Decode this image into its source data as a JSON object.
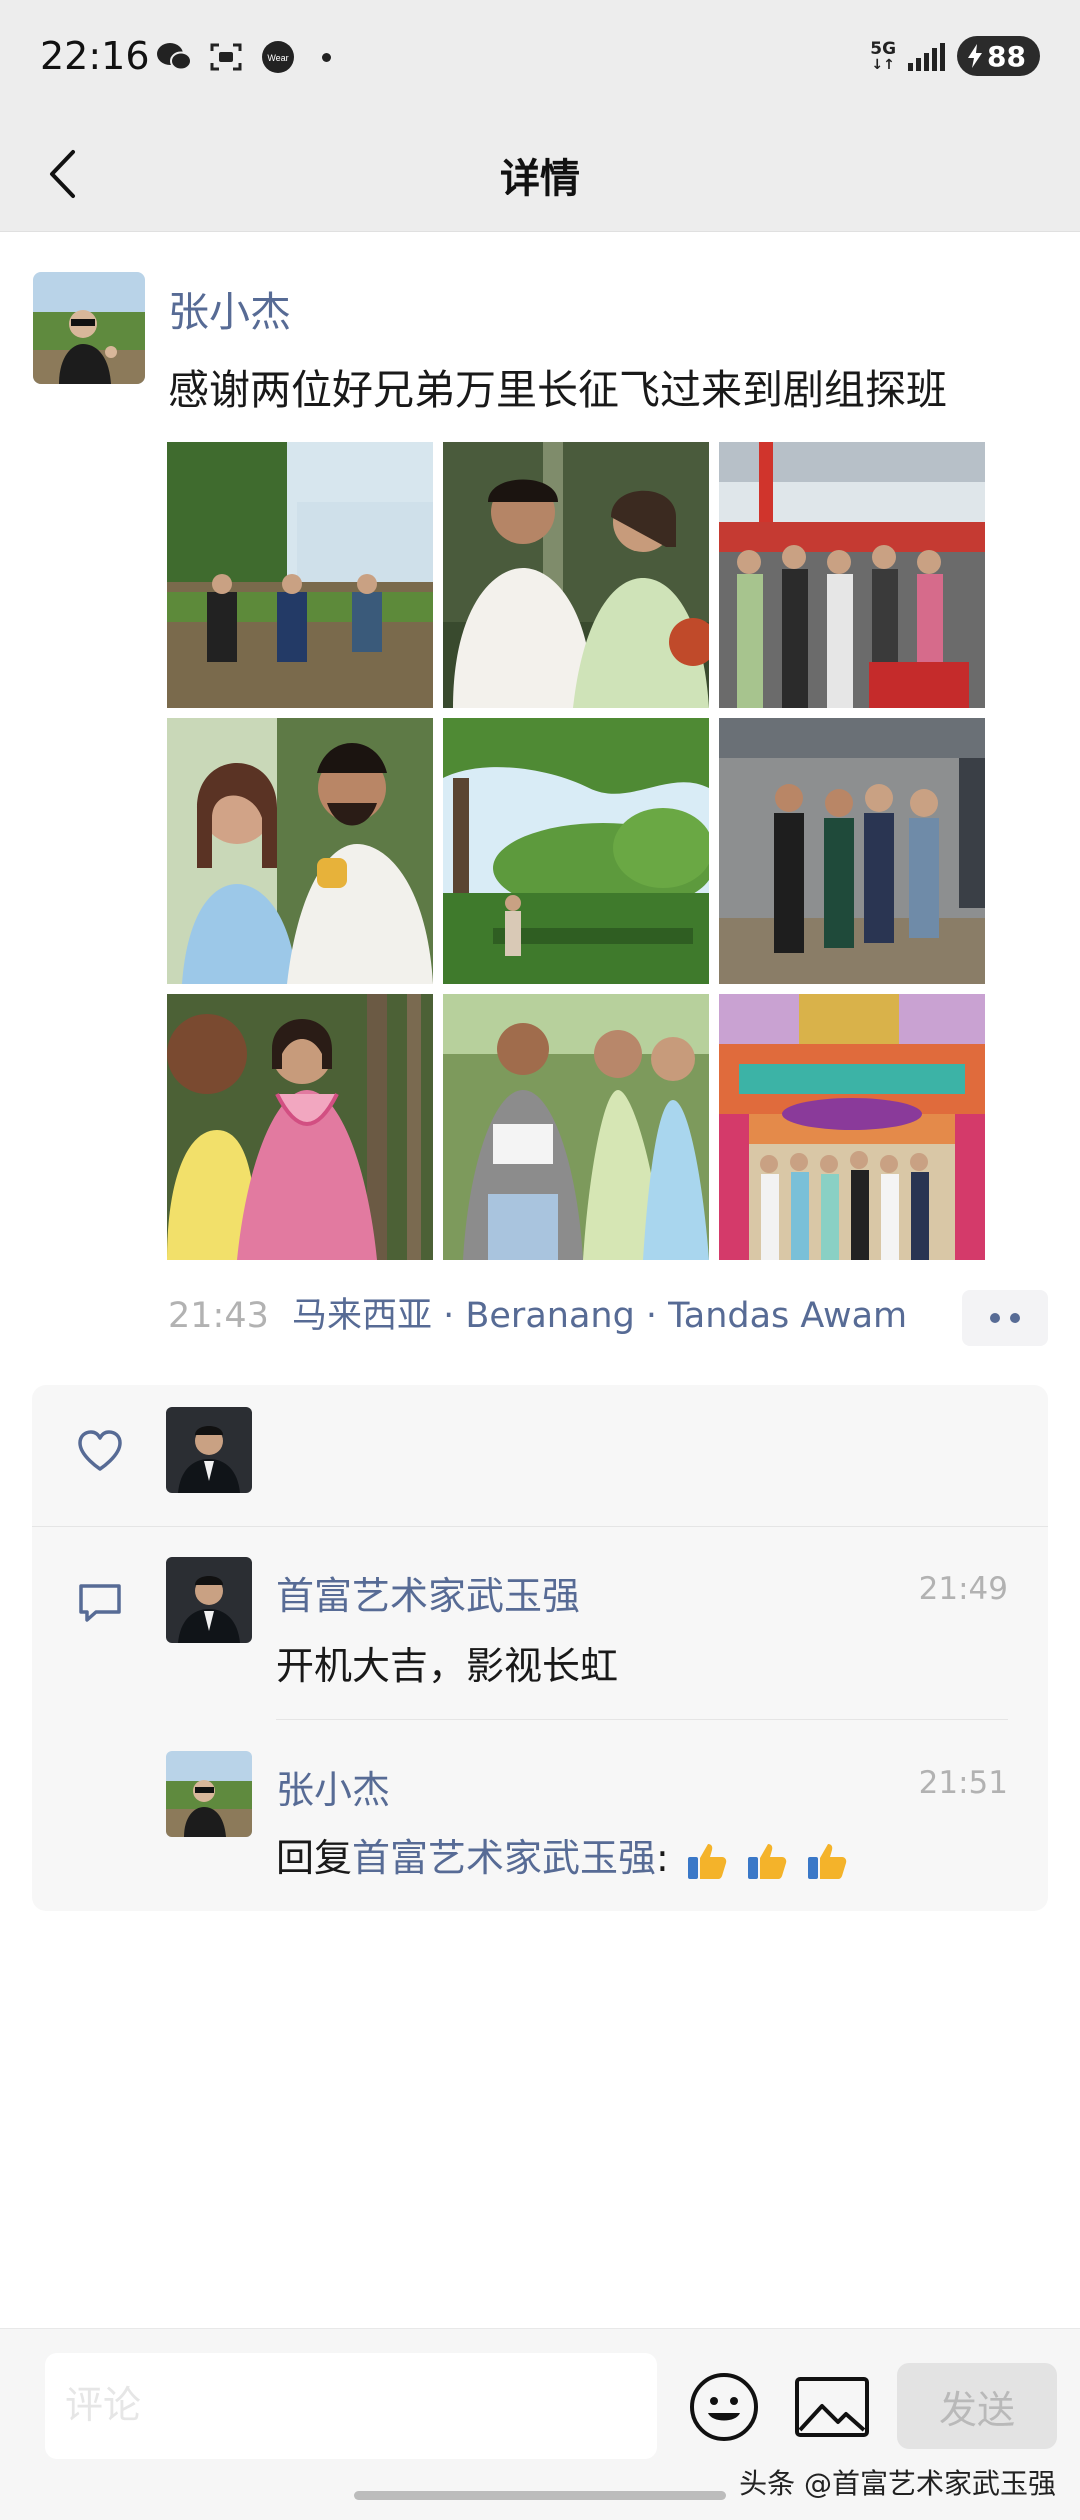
{
  "status_bar": {
    "time": "22:16",
    "icons": [
      "wechat-icon",
      "screenshot-icon",
      "wear-icon",
      "dot-icon"
    ],
    "wear_label": "Wear",
    "network": "5G",
    "battery": "88"
  },
  "nav": {
    "title": "详情",
    "back_icon": "chevron-left-icon"
  },
  "post": {
    "author": "张小杰",
    "text": "感谢两位好兄弟万里长征飞过来到剧组探班",
    "photos": [
      "photo-group-seated-outdoors",
      "photo-actors-couple",
      "photo-crowd-ceremony",
      "photo-woman-and-man-smiling",
      "photo-tree-lined-park",
      "photo-group-under-awning",
      "photo-women-pink-dress",
      "photo-women-reading-script",
      "photo-group-at-temple"
    ],
    "time": "21:43",
    "location": "马来西亚 · Beranang · Tandas Awam"
  },
  "interactions": {
    "like_icon": "heart-icon",
    "comment_icon": "comment-icon",
    "comments": [
      {
        "name": "首富艺术家武玉强",
        "time": "21:49",
        "text": "开机大吉，影视长虹"
      },
      {
        "name": "张小杰",
        "time": "21:51",
        "reply_prefix": "回复",
        "reply_to": "首富艺术家武玉强",
        "reply_suffix": ":"
      }
    ]
  },
  "input_bar": {
    "placeholder": "评论",
    "send_label": "发送"
  },
  "watermark": "头条 @首富艺术家武玉强"
}
